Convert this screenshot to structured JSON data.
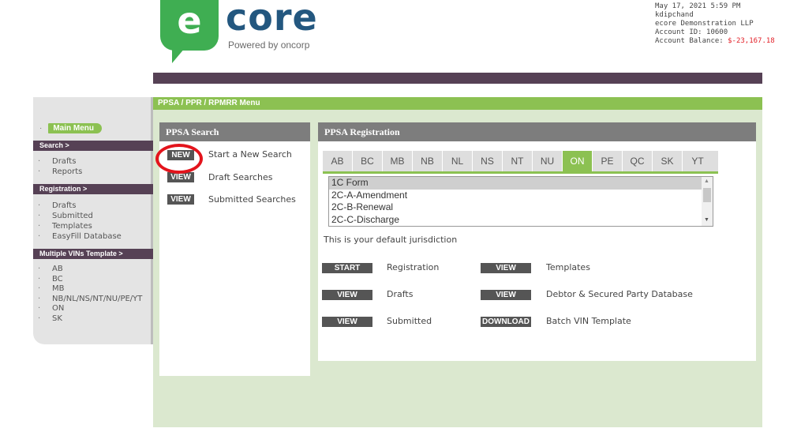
{
  "logo": {
    "letter": "e",
    "name": "core",
    "tagline": "Powered by oncorp"
  },
  "account": {
    "datetime": "May 17, 2021 5:59 PM",
    "user": "kdipchand",
    "company": "ecore Demonstration LLP",
    "account_id": "Account ID: 10600",
    "balance_label": "Account Balance:",
    "balance_value": "$-23,167.18"
  },
  "menubar": {
    "title": "PPSA / PPR / RPMRR Menu"
  },
  "sidebar": {
    "main_menu": "Main Menu",
    "search_head": "Search >",
    "search_items": [
      "Drafts",
      "Reports"
    ],
    "registration_head": "Registration >",
    "registration_items": [
      "Drafts",
      "Submitted",
      "Templates",
      "EasyFill Database"
    ],
    "vins_head": "Multiple VINs Template >",
    "vins_items": [
      "AB",
      "BC",
      "MB",
      "NB/NL/NS/NT/NU/PE/YT",
      "ON",
      "SK"
    ]
  },
  "search_panel": {
    "title": "PPSA Search",
    "rows": [
      {
        "button": "NEW",
        "label": "Start a New Search"
      },
      {
        "button": "VIEW",
        "label": "Draft Searches"
      },
      {
        "button": "VIEW",
        "label": "Submitted Searches"
      }
    ]
  },
  "registration_panel": {
    "title": "PPSA Registration",
    "tabs": [
      "AB",
      "BC",
      "MB",
      "NB",
      "NL",
      "NS",
      "NT",
      "NU",
      "ON",
      "PE",
      "QC",
      "SK",
      "YT"
    ],
    "active_tab": "ON",
    "list_options": [
      "1C Form",
      "2C-A-Amendment",
      "2C-B-Renewal",
      "2C-C-Discharge"
    ],
    "selected_option": "1C Form",
    "note": "This is your default jurisdiction",
    "actions": [
      {
        "button": "START",
        "label": "Registration"
      },
      {
        "button": "VIEW",
        "label": "Templates"
      },
      {
        "button": "VIEW",
        "label": "Drafts"
      },
      {
        "button": "VIEW",
        "label": "Debtor & Secured Party Database"
      },
      {
        "button": "VIEW",
        "label": "Submitted"
      },
      {
        "button": "DOWNLOAD",
        "label": "Batch VIN Template"
      }
    ]
  },
  "colors": {
    "green": "#8cc152",
    "plum": "#564155",
    "brand_blue": "#23577f",
    "alert_red": "#e3141c"
  }
}
